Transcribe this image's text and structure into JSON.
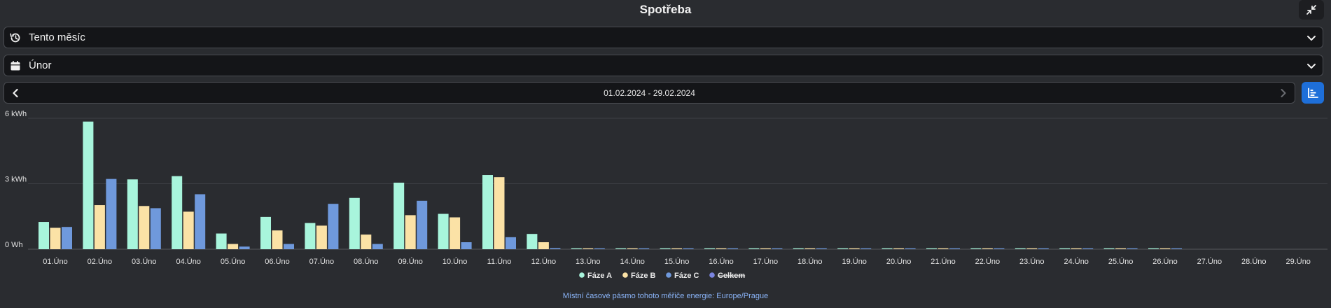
{
  "header": {
    "title": "Spotřeba"
  },
  "period_select": {
    "value": "Tento měsíc"
  },
  "month_select": {
    "value": "Únor"
  },
  "date_nav": {
    "range": "01.02.2024 - 29.02.2024"
  },
  "footer": {
    "text": "Místní časové pásmo tohoto měřiče energie: Europe/Prague"
  },
  "colors": {
    "background": "#2a2c30",
    "phase_a": "#a8f5dc",
    "phase_b": "#fbe2a6",
    "phase_c": "#6f99dc",
    "total": "#7b85e0",
    "accent": "#1e6fd9"
  },
  "chart_data": {
    "type": "bar",
    "ylim": [
      0,
      6
    ],
    "yticks": [
      {
        "value": 0,
        "label": "0 Wh"
      },
      {
        "value": 3,
        "label": "3 kWh"
      },
      {
        "value": 6,
        "label": "6 kWh"
      }
    ],
    "categories": [
      "01.Úno",
      "02.Úno",
      "03.Úno",
      "04.Úno",
      "05.Úno",
      "06.Úno",
      "07.Úno",
      "08.Úno",
      "09.Úno",
      "10.Úno",
      "11.Úno",
      "12.Úno",
      "13.Úno",
      "14.Úno",
      "15.Úno",
      "16.Úno",
      "17.Úno",
      "18.Úno",
      "19.Úno",
      "20.Úno",
      "21.Úno",
      "22.Úno",
      "23.Úno",
      "24.Úno",
      "25.Úno",
      "26.Úno",
      "27.Úno",
      "28.Úno",
      "29.Úno"
    ],
    "series": [
      {
        "name": "Fáze A",
        "color": "#a8f5dc",
        "hidden": false,
        "values": [
          1.25,
          5.85,
          3.2,
          3.35,
          0.72,
          1.48,
          1.2,
          2.35,
          3.05,
          1.62,
          3.4,
          0.7,
          0.04,
          0.04,
          0.04,
          0.04,
          0.04,
          0.04,
          0.04,
          0.04,
          0.04,
          0.04,
          0.04,
          0.04,
          0.04,
          0.04,
          0,
          0,
          0
        ]
      },
      {
        "name": "Fáze B",
        "color": "#fbe2a6",
        "hidden": false,
        "values": [
          0.98,
          2.02,
          1.98,
          1.72,
          0.24,
          0.86,
          1.08,
          0.67,
          1.56,
          1.46,
          3.3,
          0.32,
          0.04,
          0.04,
          0.04,
          0.04,
          0.04,
          0.04,
          0.04,
          0.04,
          0.04,
          0.04,
          0.04,
          0.04,
          0.04,
          0.04,
          0,
          0,
          0
        ]
      },
      {
        "name": "Fáze C",
        "color": "#6f99dc",
        "hidden": false,
        "values": [
          1.02,
          3.22,
          1.88,
          2.52,
          0.12,
          0.24,
          2.08,
          0.24,
          2.22,
          0.32,
          0.55,
          0.05,
          0.04,
          0.04,
          0.04,
          0.04,
          0.04,
          0.04,
          0.04,
          0.04,
          0.04,
          0.04,
          0.04,
          0.04,
          0.04,
          0.04,
          0,
          0,
          0
        ]
      },
      {
        "name": "Celkem",
        "color": "#7b85e0",
        "hidden": true,
        "values": []
      }
    ],
    "grid": true,
    "legend": "bottom-center"
  }
}
